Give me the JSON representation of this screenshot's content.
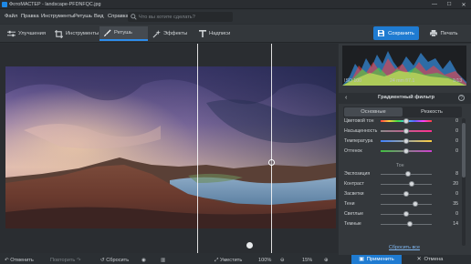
{
  "window": {
    "title": "ФотоМАСТЕР - landscape-PFDNFQC.jpg",
    "minimize": "—",
    "maximize": "☐",
    "close": "✕"
  },
  "menu": {
    "items": [
      "Файл",
      "Правка",
      "Инструменты",
      "Ретушь",
      "Вид",
      "Справка"
    ],
    "search_placeholder": "Что вы хотите сделать?"
  },
  "toolbar": {
    "tabs": [
      "Улучшения",
      "Инструменты",
      "Ретушь",
      "Эффекты",
      "Надписи"
    ],
    "active_tab": "Ретушь",
    "save_label": "Сохранить",
    "print_label": "Печать"
  },
  "histogram": {
    "iso": "ISO 100",
    "focal": "24 mm f/7.1",
    "shutter": "1/13"
  },
  "panel": {
    "title": "Градиентный фильтр",
    "tab_basic": "Основные",
    "tab_sharpness": "Резкость",
    "section_ton": "Тон",
    "reset": "Сбросить все",
    "sliders": [
      {
        "label": "Цветовой тон",
        "value": "0",
        "pos": 0.5,
        "kind": "hue"
      },
      {
        "label": "Насыщенность",
        "value": "0",
        "pos": 0.5,
        "kind": "sat"
      },
      {
        "label": "Температура",
        "value": "0",
        "pos": 0.5,
        "kind": "temp"
      },
      {
        "label": "Оттенок",
        "value": "0",
        "pos": 0.5,
        "kind": "tint"
      },
      {
        "label": "Экспозиция",
        "value": "8",
        "pos": 0.54,
        "kind": "plain"
      },
      {
        "label": "Контраст",
        "value": "20",
        "pos": 0.6,
        "kind": "plain"
      },
      {
        "label": "Засветки",
        "value": "0",
        "pos": 0.5,
        "kind": "plain"
      },
      {
        "label": "Тени",
        "value": "35",
        "pos": 0.68,
        "kind": "plain"
      },
      {
        "label": "Светлые",
        "value": "0",
        "pos": 0.5,
        "kind": "plain"
      },
      {
        "label": "Темные",
        "value": "14",
        "pos": 0.57,
        "kind": "plain"
      }
    ]
  },
  "bottom": {
    "undo": "Отменить",
    "redo": "Повторить",
    "reset": "Сбросить",
    "fit": "Уместить",
    "zoom": "100%",
    "zoom_pct": "15%",
    "apply": "Применить",
    "cancel": "Отмена"
  },
  "colors": {
    "accent": "#1f7bd1",
    "background": "#2b2f33",
    "panel": "#34383c"
  }
}
